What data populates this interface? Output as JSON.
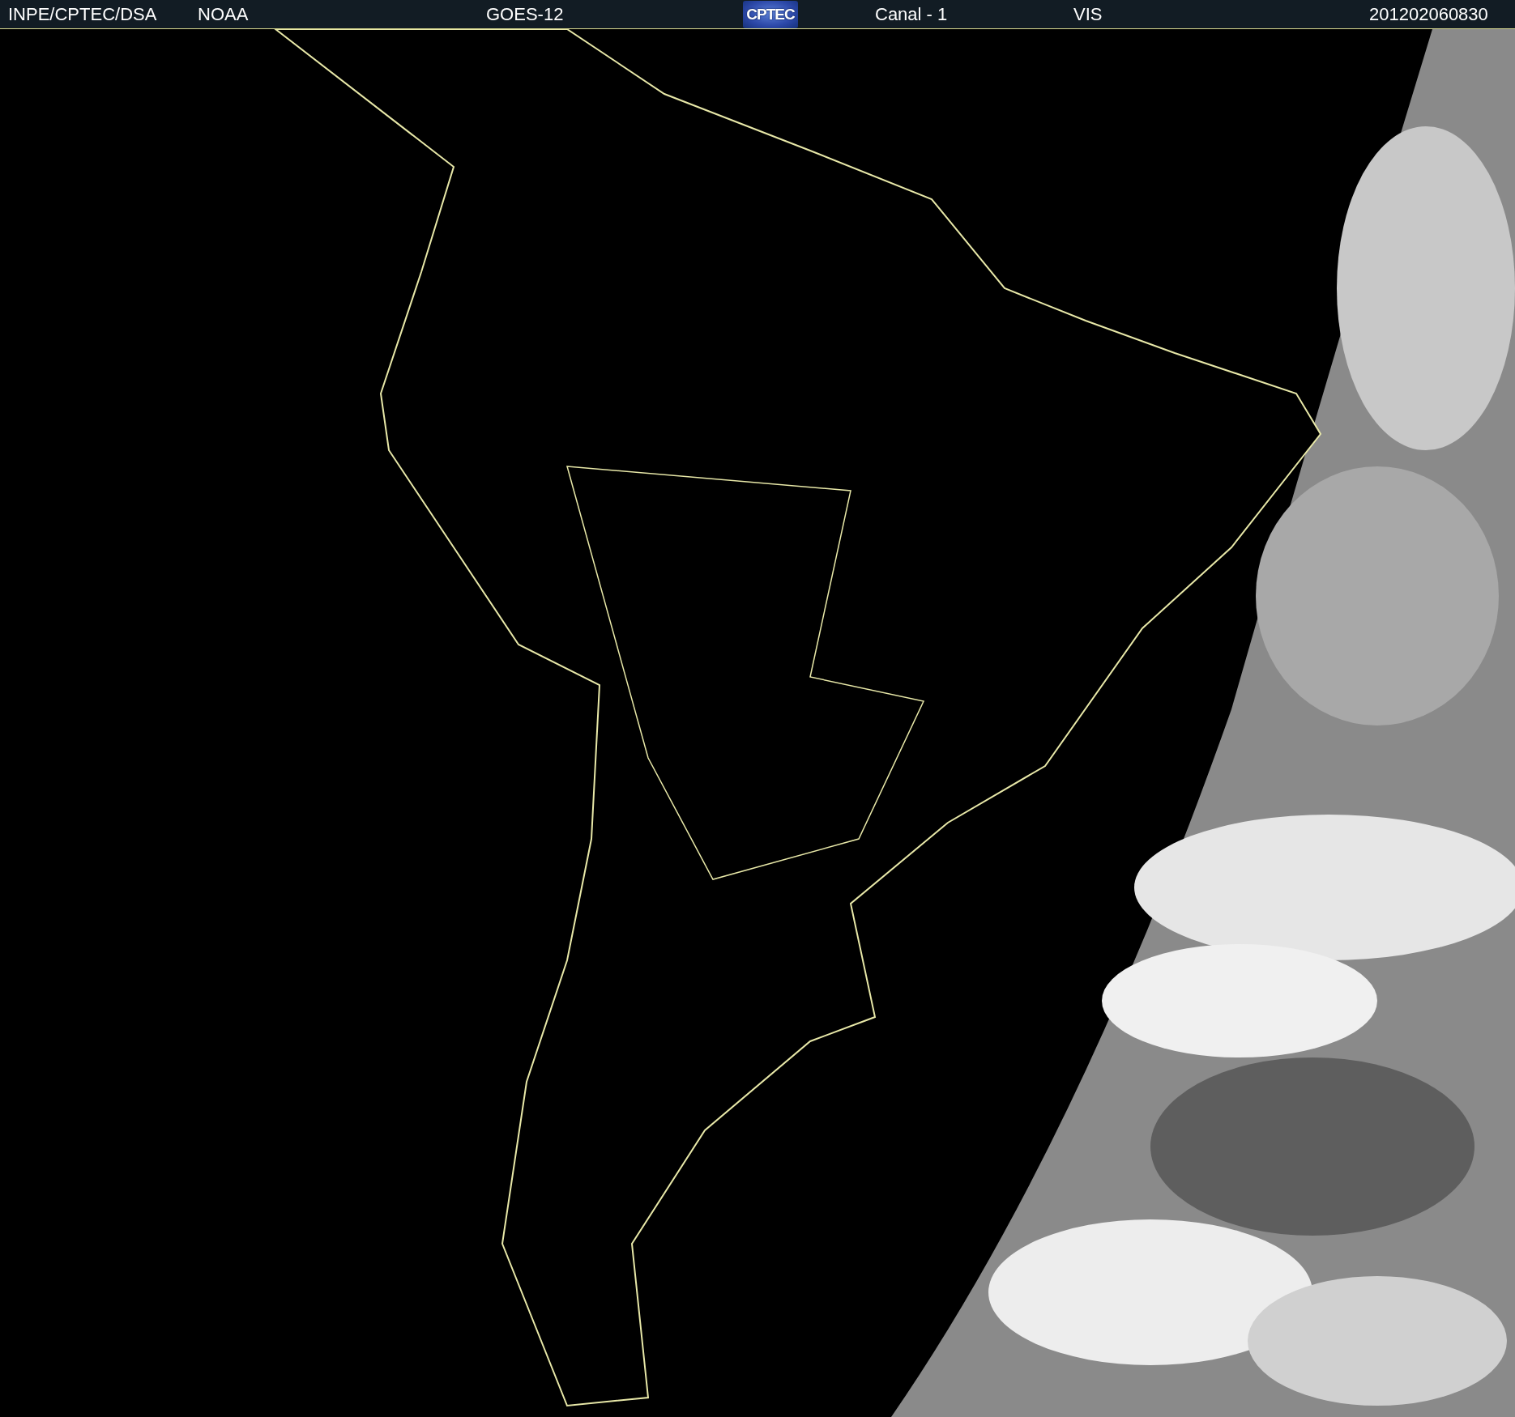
{
  "header": {
    "items": [
      {
        "kind": "text",
        "label": "INPE/CPTEC/DSA"
      },
      {
        "kind": "text",
        "label": "NOAA"
      },
      {
        "kind": "text",
        "label": "GOES-12"
      },
      {
        "kind": "logo",
        "label": "CPTEC"
      },
      {
        "kind": "text",
        "label": "Canal - 1"
      },
      {
        "kind": "text",
        "label": "VIS"
      },
      {
        "kind": "text",
        "label": "201202060830"
      }
    ]
  }
}
